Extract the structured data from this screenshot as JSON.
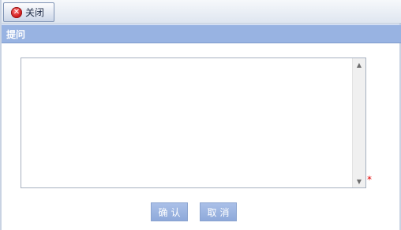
{
  "toolbar": {
    "close_label": "关闭",
    "close_icon": "close-circle-icon"
  },
  "dialog": {
    "title": "提问"
  },
  "question": {
    "value": "",
    "required_marker": "*"
  },
  "actions": {
    "confirm_label": "确认",
    "cancel_label": "取消"
  },
  "colors": {
    "title_bar": "#98b3e2",
    "button": "#98b3e2",
    "required": "#e00000"
  }
}
